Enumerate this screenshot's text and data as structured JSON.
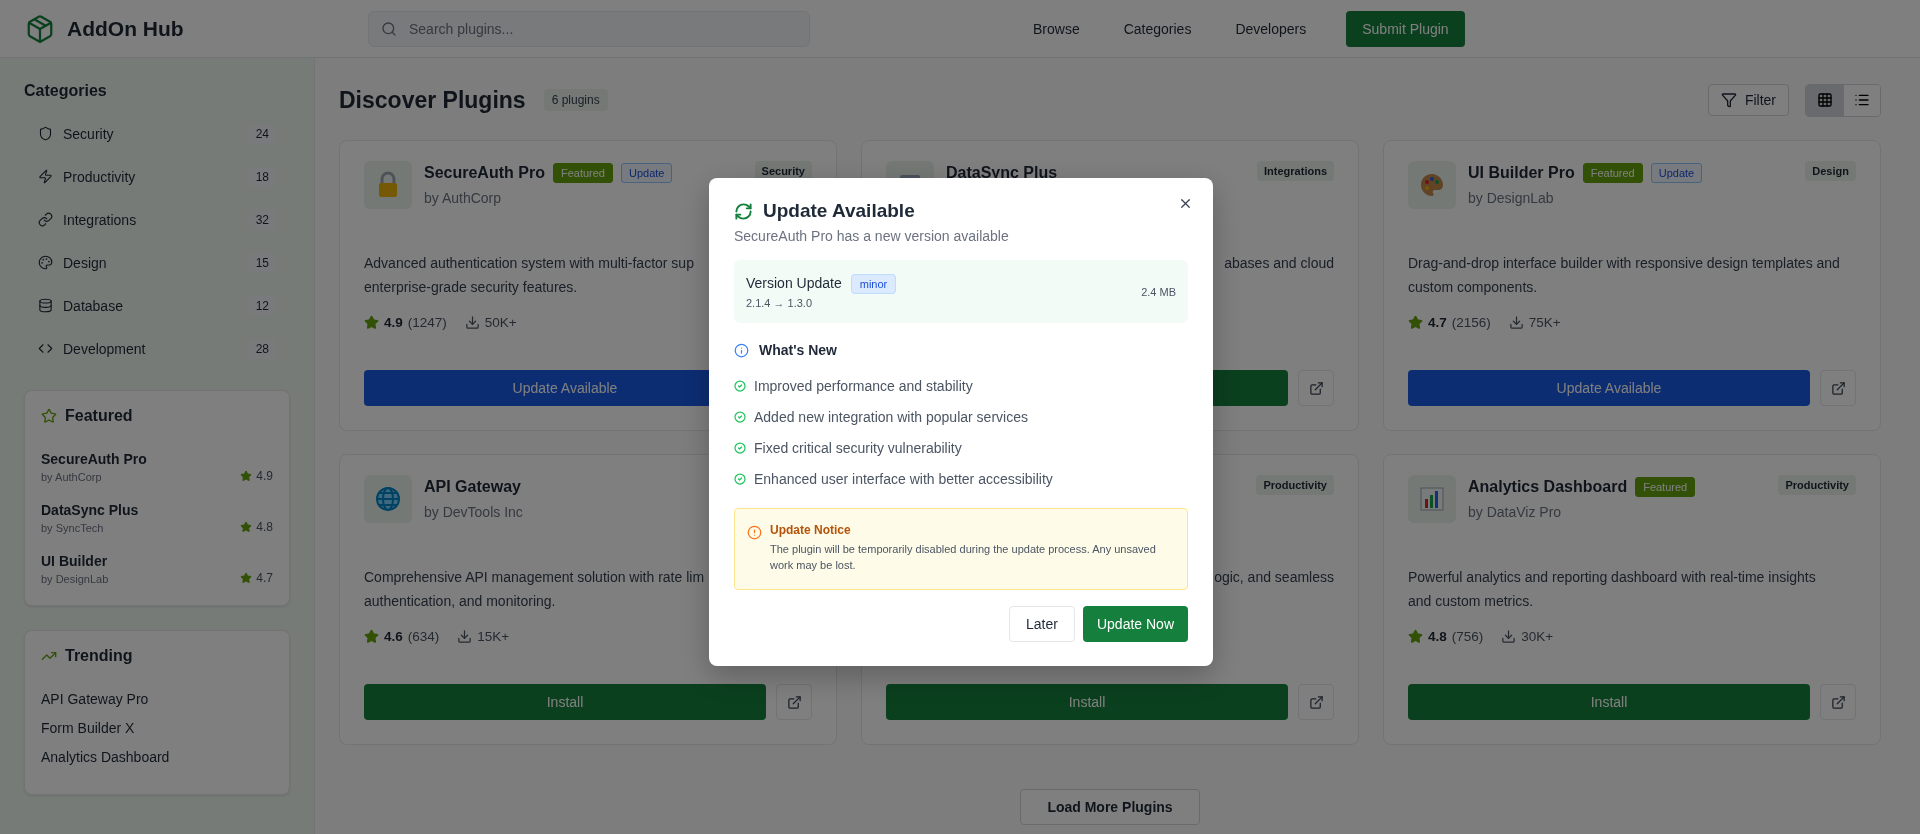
{
  "header": {
    "logo": "AddOn Hub",
    "search": {
      "placeholder": "Search plugins..."
    },
    "nav": [
      "Browse",
      "Categories",
      "Developers"
    ],
    "submit": "Submit Plugin"
  },
  "sidebar": {
    "title": "Categories",
    "categories": [
      {
        "label": "Security",
        "count": "24",
        "kind": "shield"
      },
      {
        "label": "Productivity",
        "count": "18",
        "kind": "zap"
      },
      {
        "label": "Integrations",
        "count": "32",
        "kind": "link"
      },
      {
        "label": "Design",
        "count": "15",
        "kind": "palette"
      },
      {
        "label": "Database",
        "count": "12",
        "kind": "database"
      },
      {
        "label": "Development",
        "count": "28",
        "kind": "code"
      }
    ],
    "featured": {
      "title": "Featured",
      "items": [
        {
          "name": "SecureAuth Pro",
          "author": "by AuthCorp",
          "rating": "4.9"
        },
        {
          "name": "DataSync Plus",
          "author": "by SyncTech",
          "rating": "4.8"
        },
        {
          "name": "UI Builder",
          "author": "by DesignLab",
          "rating": "4.7"
        }
      ]
    },
    "trending": {
      "title": "Trending",
      "items": [
        "API Gateway Pro",
        "Form Builder X",
        "Analytics Dashboard"
      ]
    }
  },
  "main": {
    "title": "Discover Plugins",
    "count": "6 plugins",
    "filter": "Filter",
    "view": [
      {
        "kind": "grid",
        "selected": true
      },
      {
        "kind": "list",
        "selected": false
      }
    ],
    "cards": [
      {
        "name": "SecureAuth Pro",
        "author": "by AuthCorp",
        "badges": [
          {
            "label": "Featured",
            "kind": "featured"
          },
          {
            "label": "Update",
            "kind": "update"
          }
        ],
        "category": "Security",
        "description": "Advanced authentication system with multi-factor sup\nenterprise-grade security features.",
        "rating": "4.9",
        "reviews": "(1247)",
        "downloads": "50K+",
        "action": {
          "kind": "update",
          "label": "Update Available"
        }
      },
      {
        "name": "DataSync Plus",
        "category": "Integrations",
        "description": "abases and cloud",
        "action": {
          "kind": "install"
        }
      },
      {
        "name": "UI Builder Pro",
        "author": "by DesignLab",
        "badges": [
          {
            "label": "Featured",
            "kind": "featured"
          },
          {
            "label": "Update",
            "kind": "update"
          }
        ],
        "category": "Design",
        "description": "Drag-and-drop interface builder with responsive design templates and\ncustom components.",
        "rating": "4.7",
        "reviews": "(2156)",
        "downloads": "75K+",
        "action": {
          "kind": "update",
          "label": "Update Available"
        }
      },
      {
        "name": "API Gateway",
        "author": "by DevTools Inc",
        "description": "Comprehensive API management solution with rate lim\nauthentication, and monitoring.",
        "rating": "4.6",
        "reviews": "(634)",
        "downloads": "15K+",
        "action": {
          "kind": "install",
          "label": "Install"
        }
      },
      {
        "category": "Productivity",
        "description": "ogic, and seamless",
        "action": {
          "kind": "install",
          "label": "Install"
        }
      },
      {
        "name": "Analytics Dashboard",
        "author": "by DataViz Pro",
        "badges": [
          {
            "label": "Featured",
            "kind": "featured"
          }
        ],
        "category": "Productivity",
        "description": "Powerful analytics and reporting dashboard with real-time insights\nand custom metrics.",
        "rating": "4.8",
        "reviews": "(756)",
        "downloads": "30K+",
        "action": {
          "kind": "install",
          "label": "Install"
        }
      }
    ],
    "load_more": "Load More Plugins"
  },
  "modal": {
    "title": "Update Available",
    "subtitle": "SecureAuth Pro has a new version available",
    "version": {
      "label": "Version Update",
      "type": "minor",
      "change": "2.1.4 → 1.3.0",
      "size": "2.4 MB"
    },
    "whats_new": {
      "title": "What's New",
      "items": [
        "Improved performance and stability",
        "Added new integration with popular services",
        "Fixed critical security vulnerability",
        "Enhanced user interface with better accessibility"
      ]
    },
    "notice": {
      "title": "Update Notice",
      "text": "The plugin will be temporarily disabled during the update process. Any unsaved work may be lost."
    },
    "buttons": {
      "cancel": "Later",
      "confirm": "Update Now"
    }
  }
}
